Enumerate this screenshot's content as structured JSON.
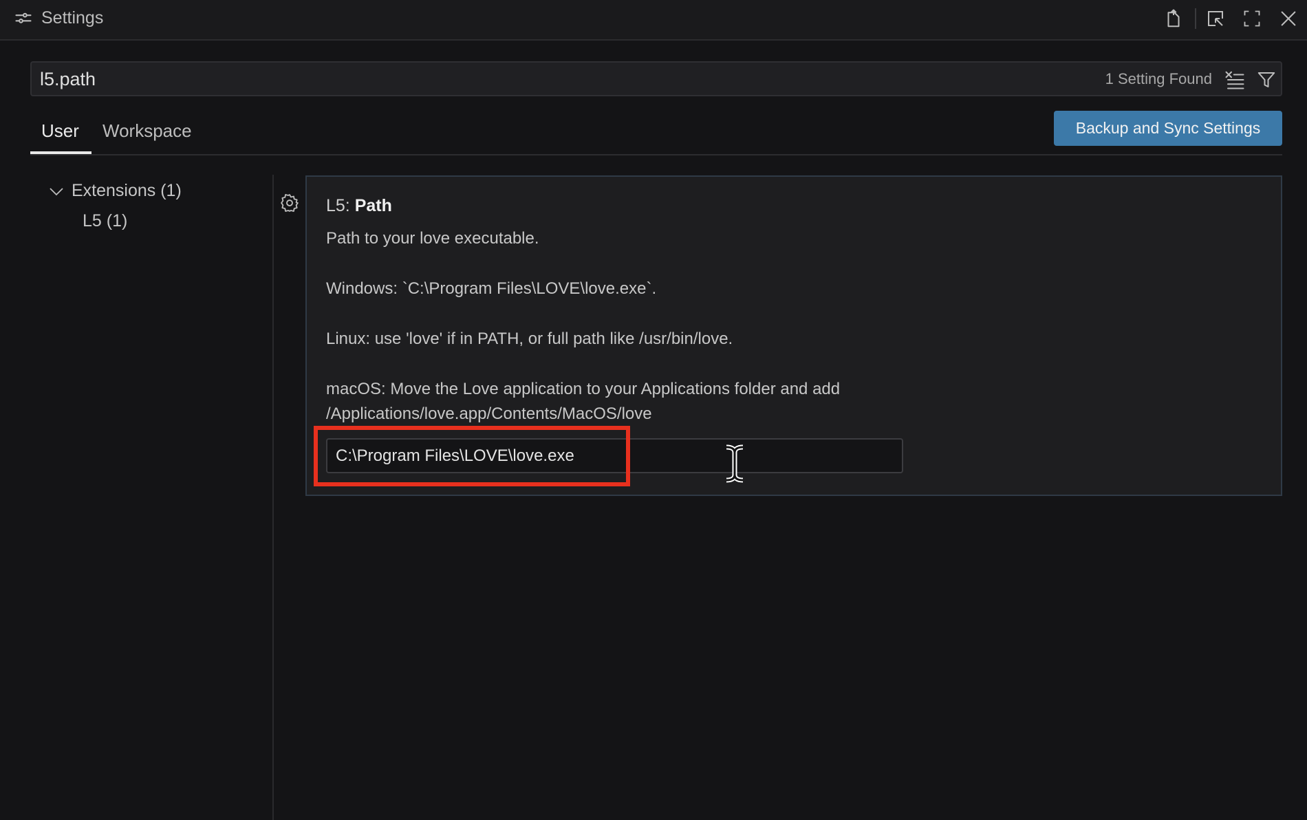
{
  "window": {
    "title": "Settings"
  },
  "search": {
    "value": "l5.path",
    "result_count": "1 Setting Found"
  },
  "tabs": [
    {
      "label": "User",
      "active": true
    },
    {
      "label": "Workspace",
      "active": false
    }
  ],
  "sync_button": {
    "label": "Backup and Sync Settings"
  },
  "tree": {
    "group_label": "Extensions (1)",
    "child_label": "L5 (1)"
  },
  "setting": {
    "scope": "L5: ",
    "name": "Path",
    "description": [
      "Path to your love executable.",
      "Windows: `C:\\Program Files\\LOVE\\love.exe`.",
      "Linux: use 'love' if in PATH, or full path like /usr/bin/love.",
      "macOS: Move the Love application to your Applications folder and add /Applications/love.app/Contents/MacOS/love"
    ],
    "value": "C:\\Program Files\\LOVE\\love.exe"
  },
  "colors": {
    "accent_button": "#3c79a8",
    "highlight_box": "#e8301e",
    "background": "#141416"
  },
  "icons": {
    "title": "settings-sliders-icon",
    "open_json": "open-settings-json-icon",
    "split": "split-editor-icon",
    "maximize": "maximize-icon",
    "close": "close-icon",
    "clear": "clear-filter-icon",
    "filter": "filter-icon",
    "tree_toggle": "chevron-down-icon",
    "setting_menu": "gear-icon",
    "text_cursor": "text-cursor-icon"
  }
}
